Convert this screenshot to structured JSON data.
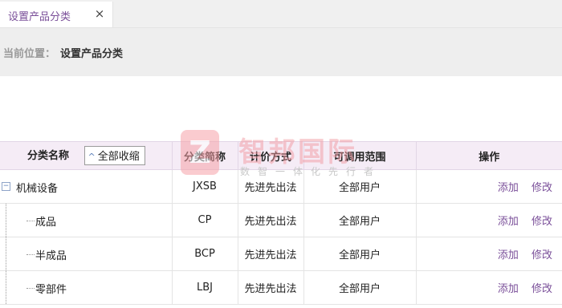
{
  "tab": {
    "label": "设置产品分类",
    "close": "×"
  },
  "breadcrumb": {
    "prefix": "当前位置：",
    "current": "设置产品分类"
  },
  "watermark": {
    "logo_letter": "Z",
    "title": "智邦国际",
    "subtitle": "数智一体化先行者"
  },
  "table": {
    "headers": {
      "name": "分类名称",
      "collapse_all": "全部收缩",
      "abbr": "分类简称",
      "pricing": "计价方式",
      "scope": "可调用范围",
      "ops": "操作"
    },
    "rows": [
      {
        "name": "机械设备",
        "abbr": "JXSB",
        "pricing": "先进先出法",
        "scope": "全部用户",
        "add": "添加",
        "edit": "修改"
      },
      {
        "name": "成品",
        "abbr": "CP",
        "pricing": "先进先出法",
        "scope": "全部用户",
        "add": "添加",
        "edit": "修改"
      },
      {
        "name": "半成品",
        "abbr": "BCP",
        "pricing": "先进先出法",
        "scope": "全部用户",
        "add": "添加",
        "edit": "修改"
      },
      {
        "name": "零部件",
        "abbr": "LBJ",
        "pricing": "先进先出法",
        "scope": "全部用户",
        "add": "添加",
        "edit": "修改"
      }
    ]
  },
  "icons": {
    "tree_toggle": "minus-box-icon",
    "collapse_caret": "chevron-up-icon"
  },
  "colors": {
    "accent": "#7a4f99",
    "header_bg": "#f5ecf6"
  }
}
